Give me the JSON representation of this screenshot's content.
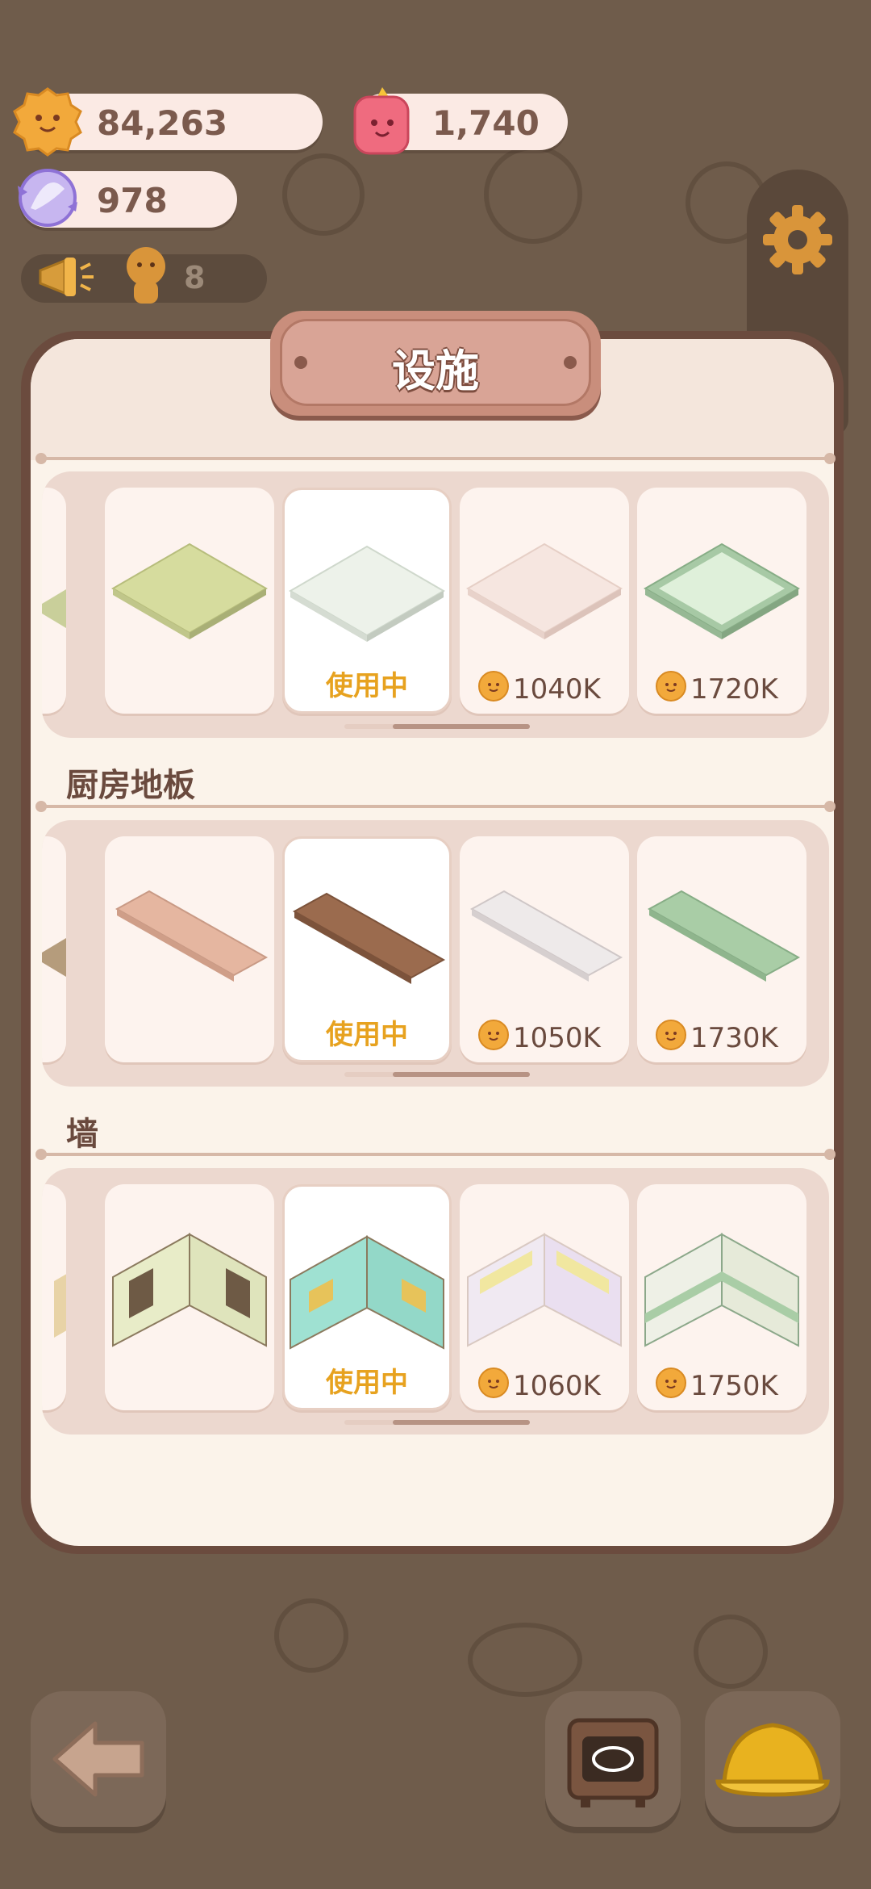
{
  "currencies": {
    "cookies": "84,263",
    "gems": "1,740",
    "candy": "978",
    "notice_count": "8"
  },
  "panel": {
    "title": "设施"
  },
  "sections": [
    {
      "title": "",
      "items": [
        {
          "status": "",
          "price": ""
        },
        {
          "status": "使用中",
          "price": ""
        },
        {
          "status": "",
          "price": "1040K"
        },
        {
          "status": "",
          "price": "1720K"
        }
      ]
    },
    {
      "title": "厨房地板",
      "items": [
        {
          "status": "",
          "price": ""
        },
        {
          "status": "使用中",
          "price": ""
        },
        {
          "status": "",
          "price": "1050K"
        },
        {
          "status": "",
          "price": "1730K"
        }
      ]
    },
    {
      "title": "墙",
      "items": [
        {
          "status": "",
          "price": ""
        },
        {
          "status": "使用中",
          "price": ""
        },
        {
          "status": "",
          "price": "1060K"
        },
        {
          "status": "",
          "price": "1750K"
        }
      ]
    }
  ],
  "icons": {
    "cookie_currency": "cookie-face-icon",
    "gem_currency": "pink-gem-icon",
    "candy_currency": "crystal-candy-icon",
    "notice": "megaphone-icon",
    "settings": "gear-icon",
    "back": "back-arrow-icon",
    "oven": "oven-icon",
    "build": "hard-hat-icon"
  },
  "colors": {
    "accent": "#e7a21f",
    "panel_frame": "#6b4b3e",
    "title_plate": "#c98e7c"
  }
}
